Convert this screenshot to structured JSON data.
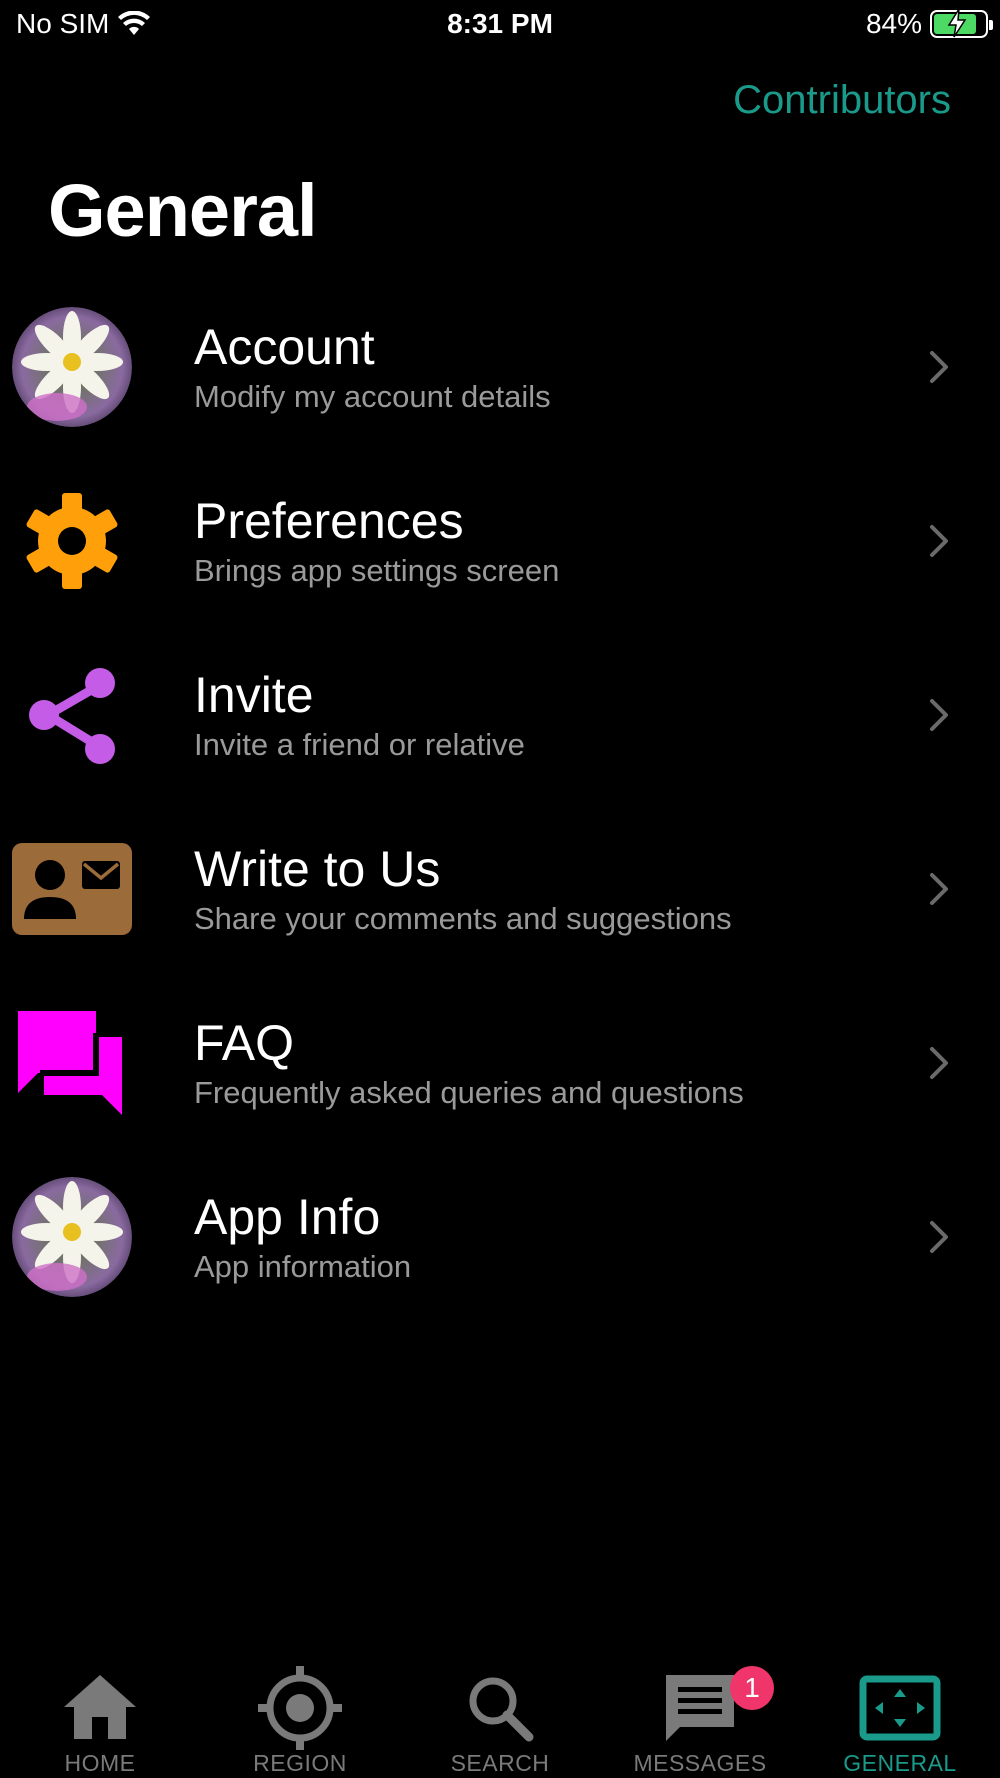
{
  "status_bar": {
    "carrier": "No SIM",
    "time": "8:31 PM",
    "battery_percent": "84%",
    "battery_level": 0.84,
    "charging": true
  },
  "header": {
    "contributors_label": "Contributors",
    "title": "General"
  },
  "menu": [
    {
      "title": "Account",
      "subtitle": "Modify my account details",
      "icon": "flower-avatar-icon"
    },
    {
      "title": "Preferences",
      "subtitle": "Brings app settings screen",
      "icon": "gear-icon"
    },
    {
      "title": "Invite",
      "subtitle": "Invite a friend or relative",
      "icon": "share-icon"
    },
    {
      "title": "Write to Us",
      "subtitle": "Share your comments and suggestions",
      "icon": "contact-mail-icon"
    },
    {
      "title": "FAQ",
      "subtitle": "Frequently asked queries and questions",
      "icon": "chat-bubbles-icon"
    },
    {
      "title": "App Info",
      "subtitle": "App information",
      "icon": "flower-avatar-icon"
    }
  ],
  "tabbar": {
    "tabs": [
      {
        "label": "HOME",
        "icon": "home-icon",
        "active": false
      },
      {
        "label": "REGION",
        "icon": "location-target-icon",
        "active": false
      },
      {
        "label": "SEARCH",
        "icon": "search-icon",
        "active": false
      },
      {
        "label": "MESSAGES",
        "icon": "message-icon",
        "active": false,
        "badge": "1"
      },
      {
        "label": "GENERAL",
        "icon": "fullscreen-frame-icon",
        "active": true
      }
    ]
  },
  "colors": {
    "accent": "#1a9a8a",
    "gear": "#ff9f0a",
    "share": "#c45ce8",
    "contact_card": "#9b6b3a",
    "faq": "#ff00ff",
    "badge": "#f0356b",
    "inactive_tab": "#7a7a7a",
    "subtitle": "#9a9a9a"
  }
}
